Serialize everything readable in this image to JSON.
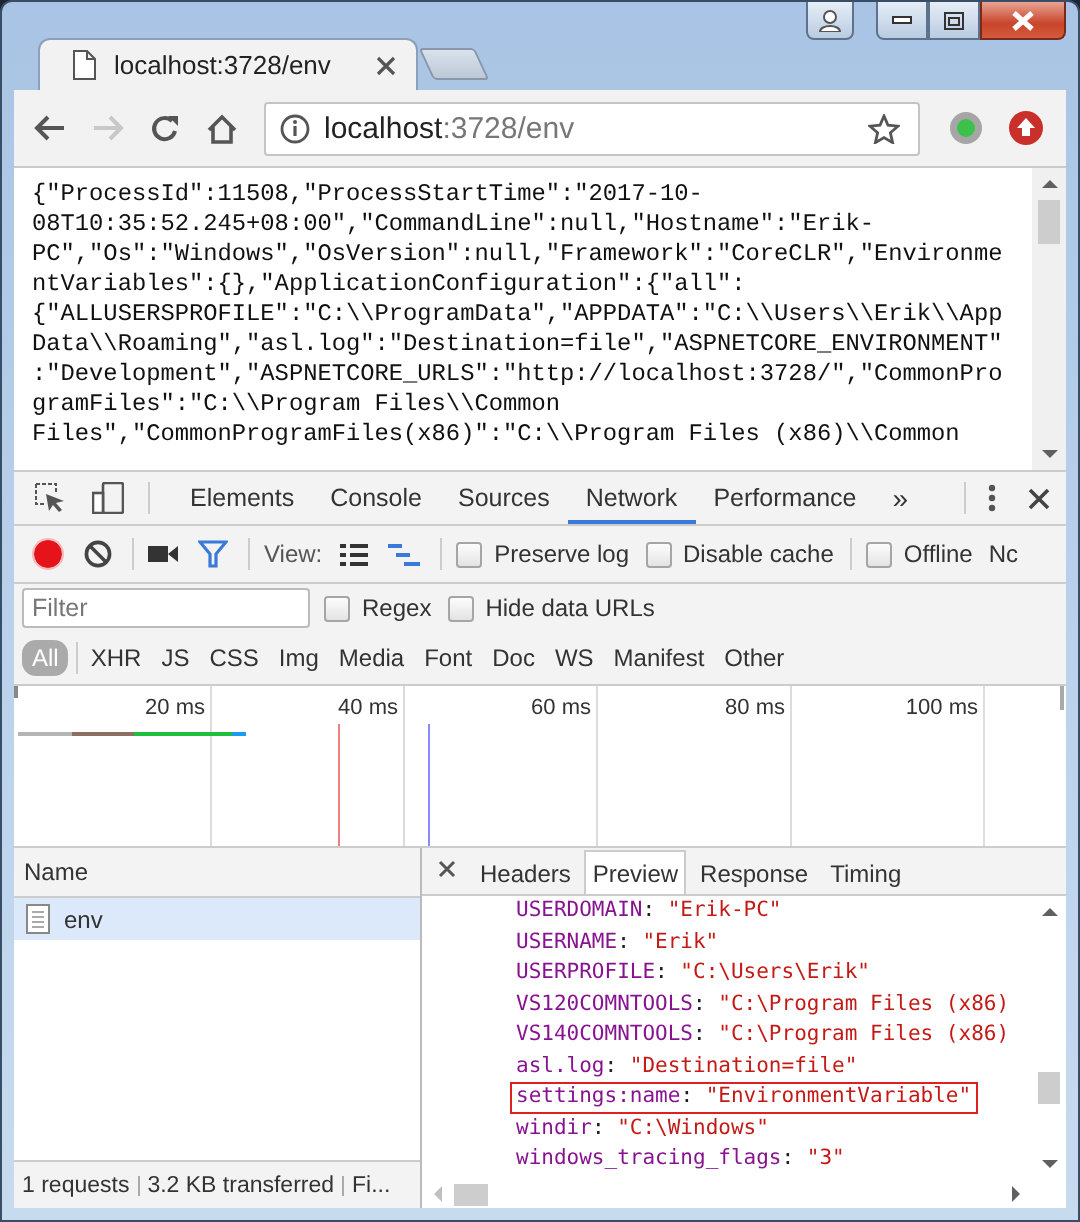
{
  "browser_tab": {
    "title": "localhost:3728/env"
  },
  "address_bar": {
    "host": "localhost",
    "path": ":3728/env"
  },
  "page": {
    "lines": [
      "{\"ProcessId\":11508,\"ProcessStartTime\":\"2017-10-",
      "08T10:35:52.245+08:00\",\"CommandLine\":null,\"Hostname\":\"Erik-",
      "PC\",\"Os\":\"Windows\",\"OsVersion\":null,\"Framework\":\"CoreCLR\",\"Environme",
      "ntVariables\":{},\"ApplicationConfiguration\":{\"all\":",
      "{\"ALLUSERSPROFILE\":\"C:\\\\ProgramData\",\"APPDATA\":\"C:\\\\Users\\\\Erik\\\\App",
      "Data\\\\Roaming\",\"asl.log\":\"Destination=file\",\"ASPNETCORE_ENVIRONMENT\"",
      ":\"Development\",\"ASPNETCORE_URLS\":\"http://localhost:3728/\",\"CommonPro",
      "gramFiles\":\"C:\\\\Program Files\\\\Common",
      "Files\",\"CommonProgramFiles(x86)\":\"C:\\\\Program Files (x86)\\\\Common"
    ]
  },
  "devtools": {
    "tabs": [
      {
        "label": "Elements",
        "selected": false
      },
      {
        "label": "Console",
        "selected": false
      },
      {
        "label": "Sources",
        "selected": false
      },
      {
        "label": "Network",
        "selected": true
      },
      {
        "label": "Performance",
        "selected": false
      }
    ],
    "more_tabs": "»",
    "toolbar": {
      "recording": true,
      "filter_on": true,
      "overview_on": true,
      "view_label": "View:",
      "options": [
        {
          "label": "Preserve log",
          "checked": false
        },
        {
          "label": "Disable cache",
          "checked": false
        },
        {
          "label": "Offline",
          "checked": false
        }
      ],
      "cut_label": "Nc"
    },
    "filter": {
      "placeholder": "Filter",
      "options": [
        {
          "label": "Regex",
          "checked": false
        },
        {
          "label": "Hide data URLs",
          "checked": false
        }
      ]
    },
    "types": [
      {
        "label": "All",
        "selected": true
      },
      {
        "label": "XHR",
        "selected": false
      },
      {
        "label": "JS",
        "selected": false
      },
      {
        "label": "CSS",
        "selected": false
      },
      {
        "label": "Img",
        "selected": false
      },
      {
        "label": "Media",
        "selected": false
      },
      {
        "label": "Font",
        "selected": false
      },
      {
        "label": "Doc",
        "selected": false
      },
      {
        "label": "WS",
        "selected": false
      },
      {
        "label": "Manifest",
        "selected": false
      },
      {
        "label": "Other",
        "selected": false
      }
    ],
    "overview": {
      "ticks": [
        "20 ms",
        "40 ms",
        "60 ms",
        "80 ms",
        "100 ms"
      ]
    },
    "requests": {
      "column": "Name",
      "rows": [
        {
          "name": "env",
          "selected": true
        }
      ]
    },
    "status": [
      "1 requests",
      "3.2 KB transferred",
      "Fi..."
    ],
    "detail_tabs": [
      {
        "label": "Headers",
        "selected": false
      },
      {
        "label": "Preview",
        "selected": true
      },
      {
        "label": "Response",
        "selected": false
      },
      {
        "label": "Timing",
        "selected": false
      }
    ],
    "preview": [
      {
        "key": "USERDOMAIN",
        "separator": ":",
        "value": "\"Erik-PC\"",
        "highlighted": false
      },
      {
        "key": "USERNAME",
        "separator": ":",
        "value": "\"Erik\"",
        "highlighted": false
      },
      {
        "key": "USERPROFILE",
        "separator": ":",
        "value": "\"C:\\Users\\Erik\"",
        "highlighted": false
      },
      {
        "key": "VS120COMNTOOLS",
        "separator": ":",
        "value": "\"C:\\Program Files (x86)",
        "highlighted": false
      },
      {
        "key": "VS140COMNTOOLS",
        "separator": ":",
        "value": "\"C:\\Program Files (x86)",
        "highlighted": false
      },
      {
        "key": "asl.log",
        "separator": ":",
        "value": "\"Destination=file\"",
        "highlighted": false
      },
      {
        "key": "settings:name",
        "separator": ":",
        "value": "\"EnvironmentVariable\"",
        "highlighted": true
      },
      {
        "key": "windir",
        "separator": ":",
        "value": "\"C:\\Windows\"",
        "highlighted": false
      },
      {
        "key": "windows_tracing_flags",
        "separator": ":",
        "value": "\"3\"",
        "highlighted": false
      }
    ]
  }
}
